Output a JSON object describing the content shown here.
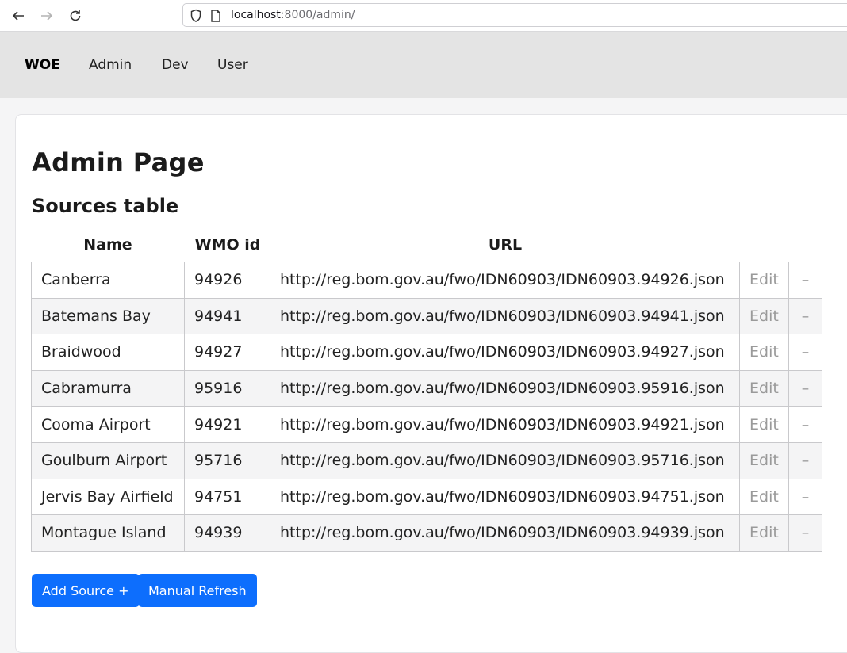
{
  "browser": {
    "url_host": "localhost",
    "url_rest": ":8000/admin/"
  },
  "navbar": {
    "brand": "WOE",
    "links": [
      "Admin",
      "Dev",
      "User"
    ]
  },
  "page": {
    "title": "Admin Page",
    "section_title": "Sources table"
  },
  "table": {
    "headers": {
      "name": "Name",
      "wmo": "WMO id",
      "url": "URL"
    },
    "edit_label": "Edit",
    "delete_label": "–",
    "rows": [
      {
        "name": "Canberra",
        "wmo": "94926",
        "url": "http://reg.bom.gov.au/fwo/IDN60903/IDN60903.94926.json"
      },
      {
        "name": "Batemans Bay",
        "wmo": "94941",
        "url": "http://reg.bom.gov.au/fwo/IDN60903/IDN60903.94941.json"
      },
      {
        "name": "Braidwood",
        "wmo": "94927",
        "url": "http://reg.bom.gov.au/fwo/IDN60903/IDN60903.94927.json"
      },
      {
        "name": "Cabramurra",
        "wmo": "95916",
        "url": "http://reg.bom.gov.au/fwo/IDN60903/IDN60903.95916.json"
      },
      {
        "name": "Cooma Airport",
        "wmo": "94921",
        "url": "http://reg.bom.gov.au/fwo/IDN60903/IDN60903.94921.json"
      },
      {
        "name": "Goulburn Airport",
        "wmo": "95716",
        "url": "http://reg.bom.gov.au/fwo/IDN60903/IDN60903.95716.json"
      },
      {
        "name": "Jervis Bay Airfield",
        "wmo": "94751",
        "url": "http://reg.bom.gov.au/fwo/IDN60903/IDN60903.94751.json"
      },
      {
        "name": "Montague Island",
        "wmo": "94939",
        "url": "http://reg.bom.gov.au/fwo/IDN60903/IDN60903.94939.json"
      }
    ]
  },
  "actions": {
    "add_source": "Add Source +",
    "manual_refresh": "Manual Refresh"
  },
  "colors": {
    "primary": "#0d6efd",
    "navbar_bg": "#e4e4e4"
  }
}
